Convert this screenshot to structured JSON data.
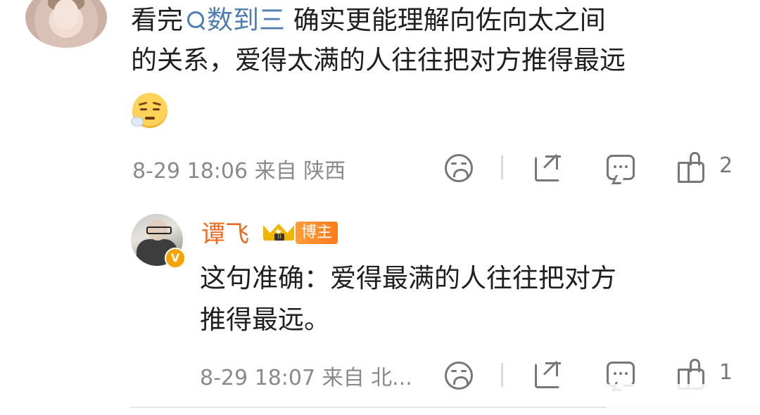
{
  "comment": {
    "prefix": "看完",
    "link_text": "数到三",
    "text_line1_rest": " 确实更能理解向佐向太之间",
    "text_line2": "的关系，爱得太满的人往往把对方推得最远",
    "emoji_icon": "tired-face-emoji",
    "meta": "8-29 18:06 来自 陕西",
    "like_count": "2"
  },
  "reply": {
    "author": "谭飞",
    "verified_badge": "V",
    "level_badge_icon": "crown-level-badge",
    "level_numeral": "II",
    "tag": "博主",
    "text_line1": "这句准确：爱得最满的人往往把对方",
    "text_line2": "推得最远。",
    "meta": "8-29 18:07 来自 北...",
    "like_count": "1"
  },
  "colors": {
    "link": "#507daf",
    "author_name": "#e86b1f",
    "tag_bg": "#ff8a2a",
    "meta": "#8a8a8a",
    "icon": "#777777"
  }
}
